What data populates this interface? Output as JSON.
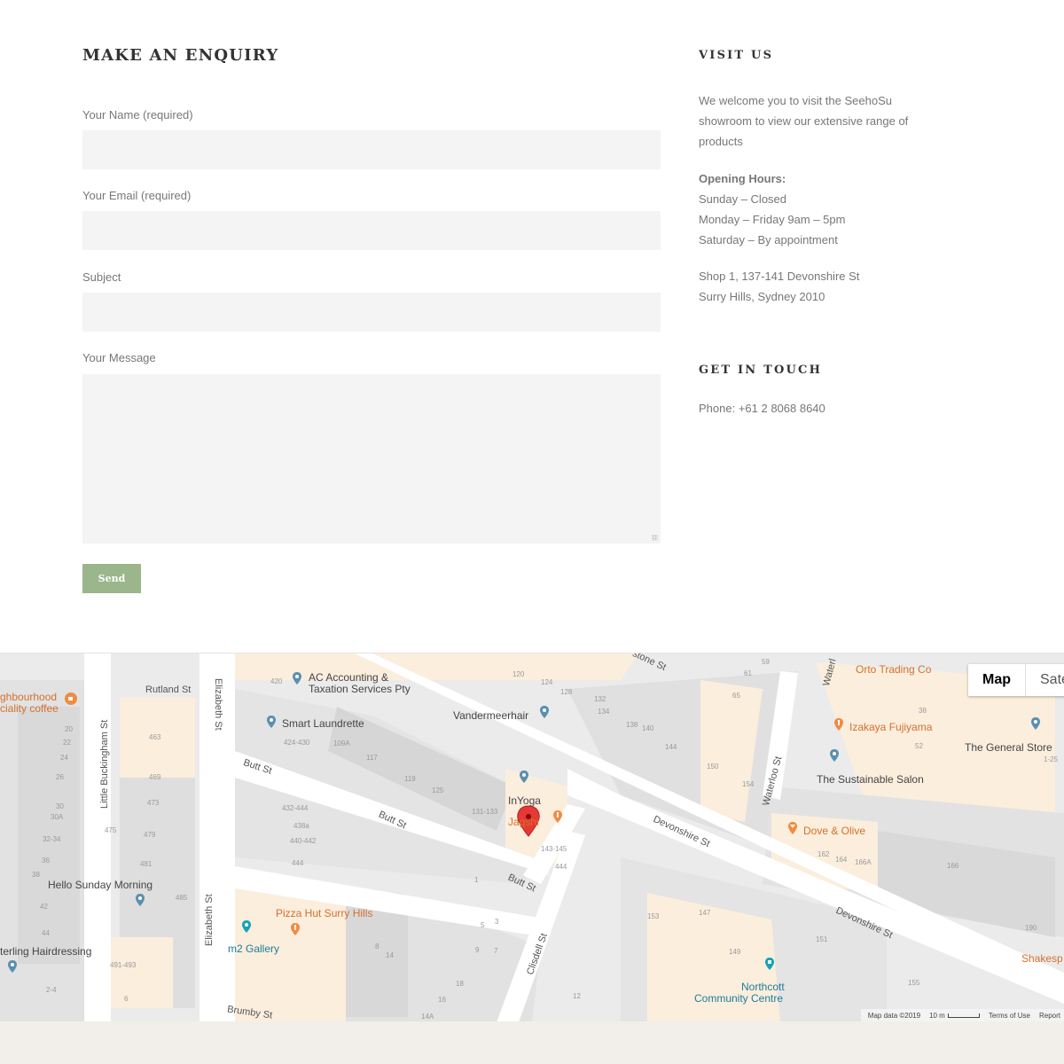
{
  "enquiry": {
    "title": "MAKE AN ENQUIRY",
    "fields": [
      {
        "label": "Your Name (required)",
        "value": ""
      },
      {
        "label": "Your Email (required)",
        "value": ""
      },
      {
        "label": "Subject",
        "value": ""
      },
      {
        "label": "Your Message",
        "value": ""
      }
    ],
    "send_label": "Send"
  },
  "visit": {
    "title": "VISIT US",
    "intro_lines": [
      "We welcome you to visit the SeehoSu",
      "showroom to view our extensive range of",
      "products"
    ],
    "hours_title": "Opening Hours:",
    "hours": [
      "Sunday – Closed",
      "Monday – Friday 9am – 5pm",
      "Saturday – By appointment"
    ],
    "address": [
      "Shop 1, 137-141 Devonshire St",
      "Surry Hills, Sydney 2010"
    ]
  },
  "contact": {
    "title": "GET IN TOUCH",
    "phone": "Phone: +61 2 8068 8640"
  },
  "map": {
    "toggle": {
      "map": "Map",
      "satellite": "Sate"
    },
    "footer": {
      "data": "Map data ©2019",
      "scale": "10 m",
      "terms": "Terms of Use",
      "report": "Report"
    },
    "places": {
      "neighbourhood": "ghbourhood",
      "coffee": "ciality coffee",
      "ac_accounting": "AC Accounting &",
      "taxation": "Taxation Services Pty",
      "smart_laundrette": "Smart Laundrette",
      "vandermeerhair": "Vandermeerhair",
      "inyoga": "InYoga",
      "jagshi": "Jagshi",
      "orto": "Orto Trading Co",
      "izakaya": "Izakaya Fujiyama",
      "general_store": "The General Store",
      "sustainable_salon": "The Sustainable Salon",
      "dove_olive": "Dove & Olive",
      "hello_sunday": "Hello Sunday Morning",
      "pizza_hut": "Pizza Hut Surry Hills",
      "m2_gallery": "m2 Gallery",
      "sterling": "terling Hairdressing",
      "northcott": "Northcott",
      "community": "Community Centre",
      "shakesp": "Shakesp"
    },
    "streets": {
      "rutland": "Rutland St",
      "elizabeth_top": "Elizabeth St",
      "elizabeth_bottom": "Elizabeth St",
      "little_buckingham": "Little Buckingham St",
      "butt_1": "Butt St",
      "butt_2": "Butt St",
      "butt_3": "Butt St",
      "devonshire_1": "Devonshire St",
      "devonshire_2": "Devonshire St",
      "waterloo": "Waterloo St",
      "waterl": "Waterl",
      "clisdell": "Clisdell St",
      "brumby": "Brumby St",
      "stone": "stone St"
    },
    "numbers": {
      "n420": "420",
      "n424": "424-430",
      "n109a": "109A",
      "n117": "117",
      "n119": "119",
      "n125": "125",
      "n131": "131-133",
      "n143": "143-145",
      "n444b": "444",
      "n120": "120",
      "n124": "124",
      "n128": "128",
      "n132": "132",
      "n134": "134",
      "n138": "138",
      "n140": "140",
      "n144": "144",
      "n150": "150",
      "n154": "154",
      "n59": "59",
      "n61": "61",
      "n65": "65",
      "n38r": "38",
      "n52": "52",
      "n125r": "1-25",
      "n162": "162",
      "n164": "164",
      "n166a": "166A",
      "n166": "166",
      "n190": "190",
      "n153": "153",
      "n147": "147",
      "n149": "149",
      "n151": "151",
      "n155": "155",
      "n12": "12",
      "n432": "432-444",
      "n438a": "438a",
      "n440": "440-442",
      "n444": "444",
      "n1": "1",
      "n5": "5",
      "n3": "3",
      "n9": "9",
      "n7": "7",
      "n8": "8",
      "n14": "14",
      "n16": "16",
      "n18": "18",
      "n14a": "14A",
      "n463": "463",
      "n469": "469",
      "n473": "473",
      "n475": "475",
      "n479": "479",
      "n481": "481",
      "n485": "485",
      "n491": "491-493",
      "n6": "6",
      "n20": "20",
      "n22": "22",
      "n24": "24",
      "n26": "26",
      "n30": "30",
      "n30a": "30A",
      "n3234": "32-34",
      "n36": "36",
      "n38": "38",
      "n42": "42",
      "n44": "44",
      "n24l": "2-4"
    }
  }
}
